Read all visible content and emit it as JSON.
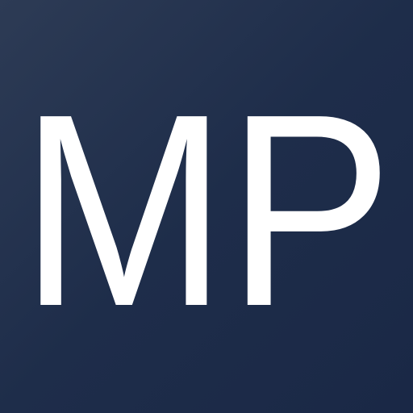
{
  "logo": {
    "monogram": "MP",
    "background_color": "#1e2d4a",
    "background_highlight_color": "#2d3b55",
    "text_color": "#ffffff"
  }
}
